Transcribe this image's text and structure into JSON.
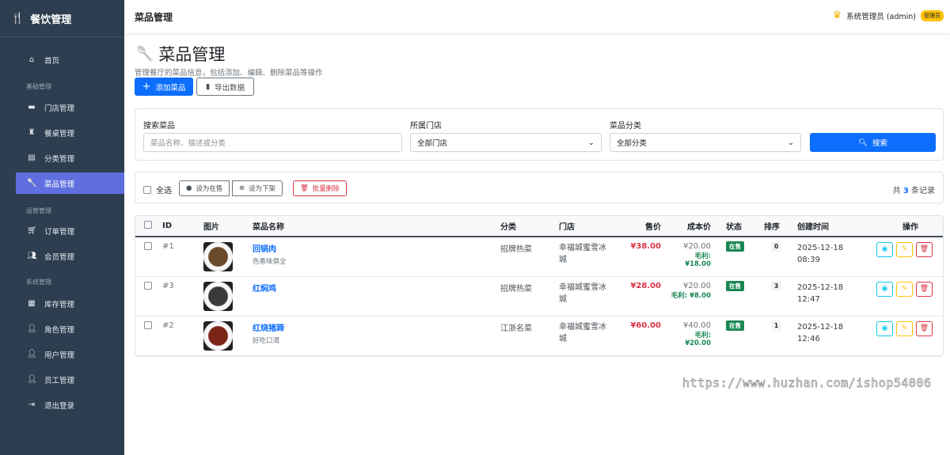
{
  "sidebar": {
    "brand": "餐饮管理",
    "items": [
      {
        "label": "首页",
        "icon": "home-icon"
      },
      {
        "section": "基础管理"
      },
      {
        "label": "门店管理",
        "icon": "store-icon"
      },
      {
        "label": "餐桌管理",
        "icon": "chair-icon"
      },
      {
        "label": "分类管理",
        "icon": "category-icon"
      },
      {
        "label": "菜品管理",
        "icon": "spoon-icon",
        "active": true
      },
      {
        "section": "运营管理"
      },
      {
        "label": "订单管理",
        "icon": "cart-icon"
      },
      {
        "label": "会员管理",
        "icon": "users-icon"
      },
      {
        "section": "系统管理"
      },
      {
        "label": "库存管理",
        "icon": "boxes-icon"
      },
      {
        "label": "角色管理",
        "icon": "user-gear-icon"
      },
      {
        "label": "用户管理",
        "icon": "user-gear-icon"
      },
      {
        "label": "员工管理",
        "icon": "user-icon"
      },
      {
        "label": "退出登录",
        "icon": "logout-icon"
      }
    ]
  },
  "header": {
    "title": "菜品管理",
    "user": "系统管理员 (admin)",
    "role_badge": "管理员"
  },
  "page": {
    "title": "菜品管理",
    "subtitle": "管理餐厅的菜品信息，包括添加、编辑、删除菜品等操作",
    "add_label": "添加菜品",
    "export_label": "导出数据"
  },
  "filters": {
    "search_label": "搜索菜品",
    "search_placeholder": "菜品名称、描述或分类",
    "store_label": "所属门店",
    "store_value": "全部门店",
    "category_label": "菜品分类",
    "category_value": "全部分类",
    "search_button": "搜索"
  },
  "bulk": {
    "select_all": "全选",
    "on_sale": "设为在售",
    "off_sale": "设为下架",
    "delete": "批量删除",
    "total_prefix": "共",
    "total": "3",
    "total_suffix": "条记录"
  },
  "table": {
    "headers": [
      "ID",
      "图片",
      "菜品名称",
      "分类",
      "门店",
      "售价",
      "成本价",
      "状态",
      "排序",
      "创建时间",
      "操作"
    ],
    "rows": [
      {
        "id": "#1",
        "name": "回锅肉",
        "desc": "色香味俱全",
        "category": "招牌热菜",
        "store": "幸福城蜜雪冰城",
        "price": "¥38.00",
        "cost": "¥20.00",
        "profit": "毛利: ¥18.00",
        "status": "在售",
        "sort": "0",
        "date": "2025-12-18",
        "time": "08:39",
        "img": "#6b4a2a"
      },
      {
        "id": "#3",
        "name": "红焖鸡",
        "desc": "",
        "category": "招牌热菜",
        "store": "幸福城蜜雪冰城",
        "price": "¥28.00",
        "cost": "¥20.00",
        "profit": "毛利: ¥8.00",
        "status": "在售",
        "sort": "3",
        "date": "2025-12-18",
        "time": "12:47",
        "img": "#3a3a3a"
      },
      {
        "id": "#2",
        "name": "红烧猪蹄",
        "desc": "好吃口渴",
        "category": "江浙名菜",
        "store": "幸福城蜜雪冰城",
        "price": "¥60.00",
        "cost": "¥40.00",
        "profit": "毛利: ¥20.00",
        "status": "在售",
        "sort": "1",
        "date": "2025-12-18",
        "time": "12:46",
        "img": "#7a2418"
      }
    ]
  },
  "watermark": "https://www.huzhan.com/ishop54006"
}
